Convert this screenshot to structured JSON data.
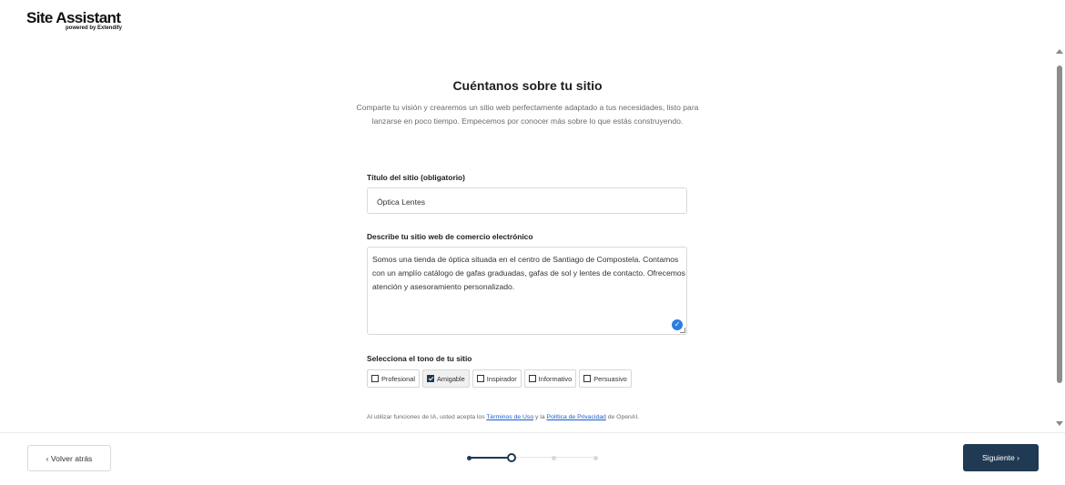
{
  "brand": {
    "title": "Site Assistant",
    "subtitle": "powered by Extendify"
  },
  "main": {
    "title": "Cuéntanos sobre tu sitio",
    "subtitle": "Comparte tu visión y crearemos un sitio web perfectamente adaptado a tus necesidades, listo para lanzarse en poco tiempo. Empecemos por conocer más sobre lo que estás construyendo.",
    "site_title_label": "Título del sitio (obligatorio)",
    "site_title_value": "Óptica Lentes",
    "description_label": "Describe tu sitio web de comercio electrónico",
    "description_value": "Somos una tienda de óptica situada en el centro de Santiago de Compostela. Contamos con un amplío catálogo de gafas graduadas, gafas de sol y lentes de contacto. Ofrecemos atención y asesoramiento personalizado.",
    "tone_label": "Selecciona el tono de tu sitio",
    "tones": [
      {
        "label": "Profesional",
        "checked": false
      },
      {
        "label": "Amigable",
        "checked": true
      },
      {
        "label": "Inspirador",
        "checked": false
      },
      {
        "label": "Informativo",
        "checked": false
      },
      {
        "label": "Persuasivo",
        "checked": false
      }
    ],
    "legal": {
      "prefix": "Al utilizar funciones de IA, usted acepta los ",
      "terms_link": "Términos de Uso",
      "middle": " y la ",
      "privacy_link": "Política de Privacidad",
      "suffix": " de OpenAI."
    }
  },
  "footer": {
    "back_label": "‹ Volver atrás",
    "next_label": "Siguiente ›",
    "steps_total": 4,
    "current_step": 2
  },
  "colors": {
    "primary": "#1f3a52",
    "link": "#1a5cc7",
    "accent_badge": "#2a7de1"
  }
}
